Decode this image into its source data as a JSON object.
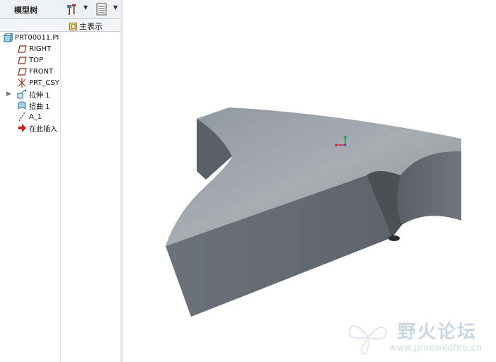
{
  "panel": {
    "title": "模型树",
    "show_label": "主表示"
  },
  "tree": [
    {
      "label": "PRT00011.PI",
      "icon": "part-icon"
    },
    {
      "label": "RIGHT",
      "icon": "datum-plane-icon"
    },
    {
      "label": "TOP",
      "icon": "datum-plane-icon"
    },
    {
      "label": "FRONT",
      "icon": "datum-plane-icon"
    },
    {
      "label": "PRT_CSY",
      "icon": "coordinate-system-icon"
    },
    {
      "label": "拉伸 1",
      "icon": "extrude-icon"
    },
    {
      "label": "扭曲 1",
      "icon": "warp-icon"
    },
    {
      "label": "A_1",
      "icon": "axis-icon"
    },
    {
      "label": "在此插入",
      "icon": "insert-here-icon"
    }
  ],
  "watermark": {
    "title": "野火论坛",
    "url": "www.proewildfire.cn"
  },
  "colors": {
    "panel_bg": "#ffffff",
    "toolbar_bg": "#eef0f3",
    "model_surface": "#7d858d",
    "model_dark": "#555b61",
    "insert_arrow": "#cc1f1f"
  }
}
